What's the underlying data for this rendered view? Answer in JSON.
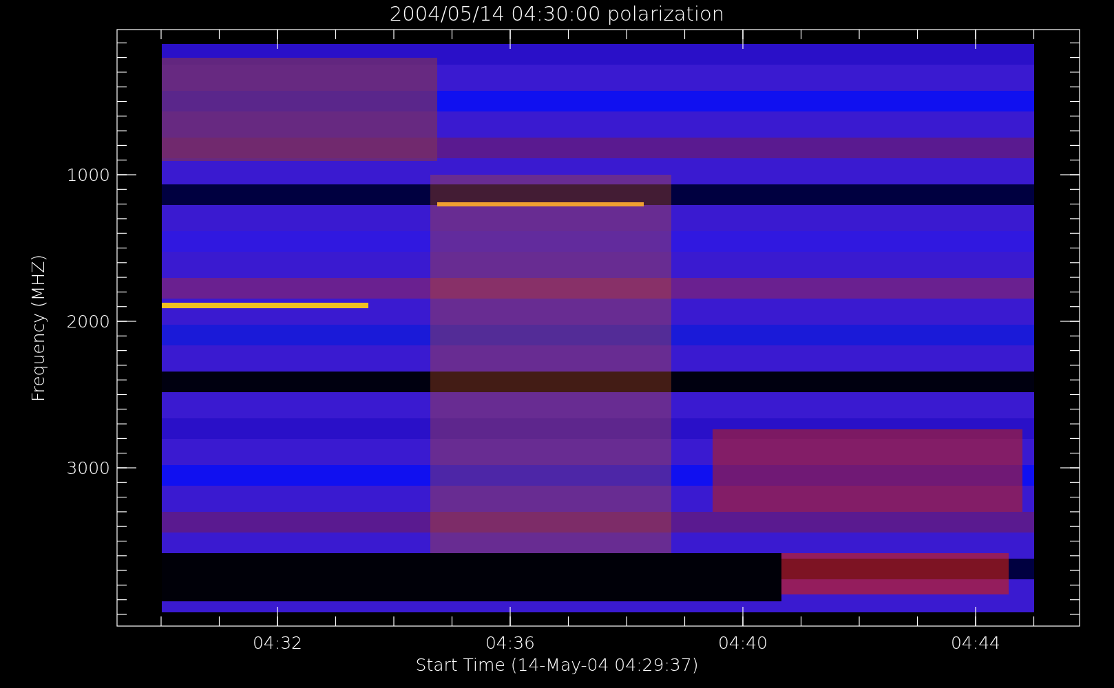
{
  "title": "2004/05/14 04:30:00 polarization",
  "y_axis": {
    "label": "Frequency (MHZ)",
    "ticks": [
      "1000",
      "2000",
      "3000"
    ]
  },
  "x_axis": {
    "label": "Start Time (14-May-04 04:29:37)",
    "ticks": [
      "04:32",
      "04:36",
      "04:40",
      "04:44"
    ]
  }
}
